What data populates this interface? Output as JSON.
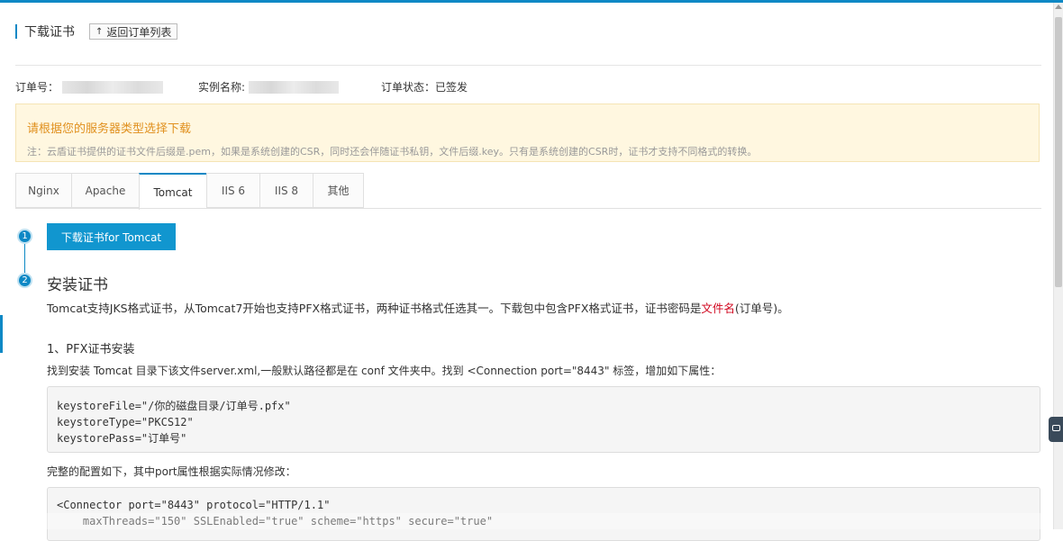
{
  "header": {
    "title": "下载证书",
    "back_label": "返回订单列表"
  },
  "order_info": {
    "order_no_label": "订单号：",
    "instance_label": "实例名称:",
    "status_label": "订单状态：",
    "status_value": "已签发"
  },
  "notice": {
    "title": "请根据您的服务器类型选择下载",
    "text": "注：云盾证书提供的证书文件后缀是.pem，如果是系统创建的CSR，同时还会伴随证书私钥，文件后缀.key。只有是系统创建的CSR时，证书才支持不同格式的转换。"
  },
  "tabs": [
    {
      "label": "Nginx"
    },
    {
      "label": "Apache"
    },
    {
      "label": "Tomcat"
    },
    {
      "label": "IIS 6"
    },
    {
      "label": "IIS 8"
    },
    {
      "label": "其他"
    }
  ],
  "active_tab": "Tomcat",
  "steps": {
    "one": "1",
    "two": "2"
  },
  "download_button": "下载证书for Tomcat",
  "install": {
    "title": "安装证书",
    "desc_before": "Tomcat支持JKS格式证书，从Tomcat7开始也支持PFX格式证书，两种证书格式任选其一。下载包中包含PFX格式证书，证书密码是",
    "desc_highlight": "文件名",
    "desc_after": "(订单号)。",
    "pfx_title": "1、PFX证书安装",
    "pfx_desc": "找到安装 Tomcat 目录下该文件server.xml,一般默认路径都是在 conf 文件夹中。找到 <Connection port=\"8443\" 标签，增加如下属性：",
    "code1": [
      "keystoreFile=\"/你的磁盘目录/订单号.pfx\"",
      "keystoreType=\"PKCS12\"",
      "keystorePass=\"订单号\""
    ],
    "config_desc": "完整的配置如下，其中port属性根据实际情况修改：",
    "code2": [
      "<Connector port=\"8443\" protocol=\"HTTP/1.1\"",
      "    maxThreads=\"150\" SSLEnabled=\"true\" scheme=\"https\" secure=\"true\""
    ]
  },
  "colors": {
    "accent": "#0d88c5",
    "button": "#1196cf",
    "notice_title": "#e0901e",
    "highlight": "#d0021b"
  }
}
